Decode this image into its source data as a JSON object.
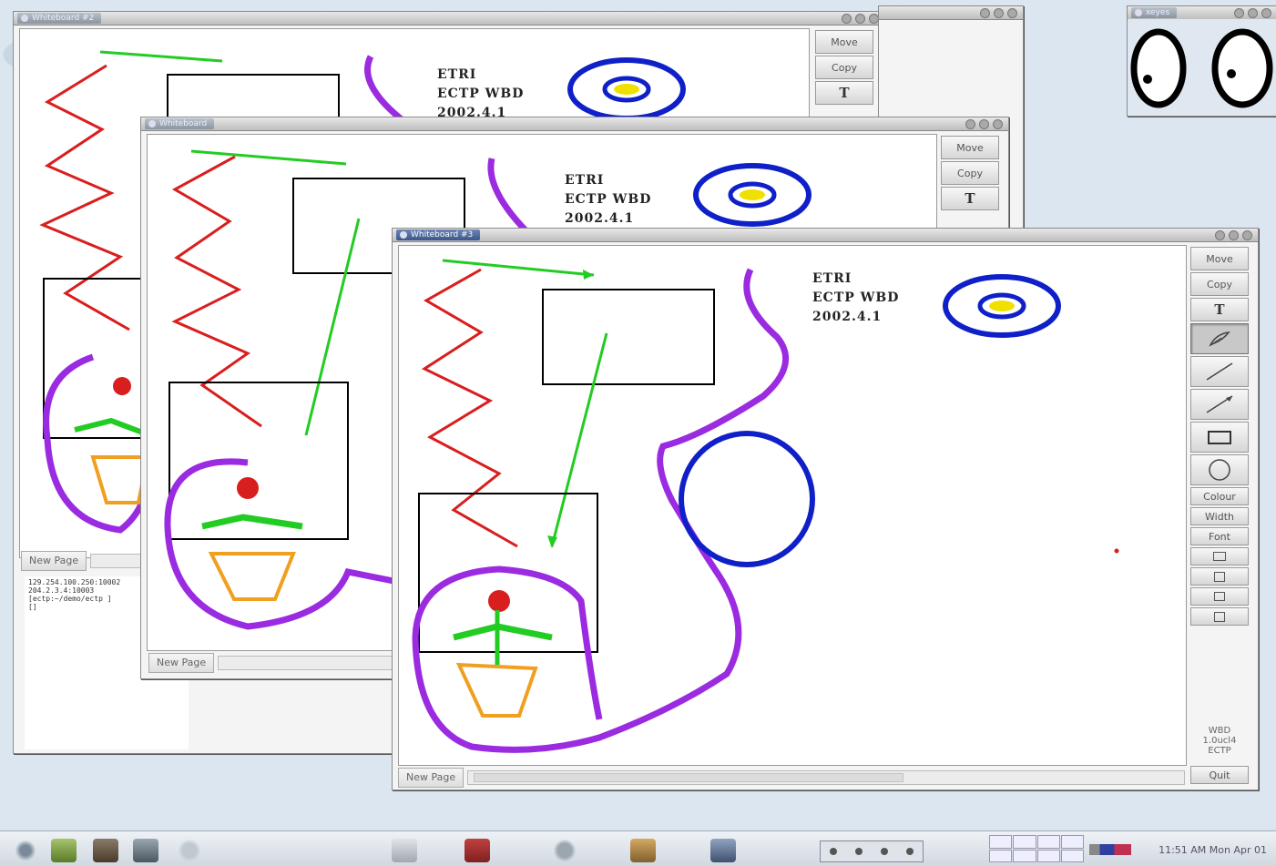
{
  "window_title": "Whiteboard #3",
  "back_window_titles": [
    "Whiteboard #2",
    "Whiteboard"
  ],
  "xeyes_title": "xeyes",
  "toolbar": {
    "move": "Move",
    "copy": "Copy",
    "text_tool": "T",
    "colour": "Colour",
    "width": "Width",
    "font": "Font",
    "quit": "Quit"
  },
  "version_info": [
    "WBD",
    "1.0ucl4",
    "ECTP"
  ],
  "bottom": {
    "new_page": "New Page"
  },
  "drawing_text": {
    "line1": "ETRI",
    "line2": "ECTP WBD",
    "line3": "2002.4.1"
  },
  "terminal_lines": [
    "129.254.100.250:10002",
    "204.2.3.4:10003",
    "[ectp:~/demo/ectp ]",
    "[]"
  ],
  "clock": "11:51 AM Mon Apr 01",
  "icons": {
    "pen": "pen-icon",
    "line": "line-icon",
    "arrow": "arrow-line-icon",
    "rect": "rectangle-icon",
    "circle": "circle-icon"
  },
  "colors": {
    "red": "#d91e1e",
    "green": "#22cc22",
    "purple": "#9a2be0",
    "blue": "#1020c8",
    "yellow": "#f0e000",
    "orange": "#f0a020"
  }
}
